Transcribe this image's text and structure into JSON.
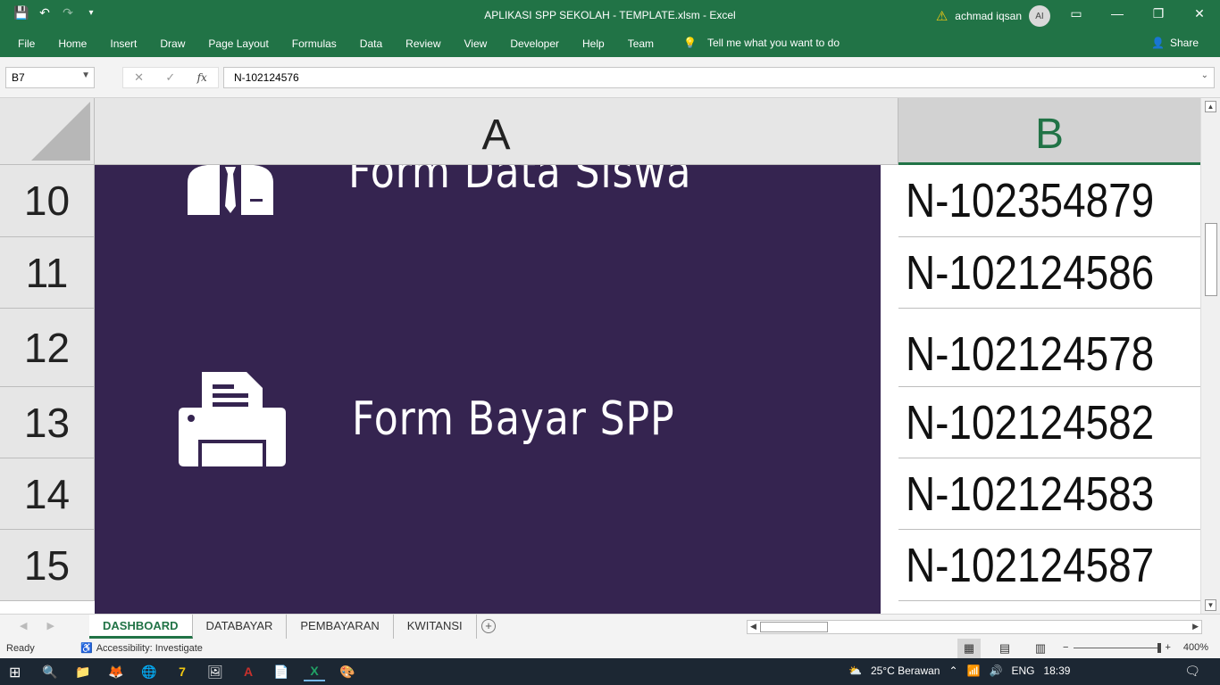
{
  "titlebar": {
    "title": "APLIKASI SPP SEKOLAH - TEMPLATE.xlsm  -  Excel",
    "user_name": "achmad iqsan",
    "avatar_initials": "AI"
  },
  "menu": [
    "File",
    "Home",
    "Insert",
    "Draw",
    "Page Layout",
    "Formulas",
    "Data",
    "Review",
    "View",
    "Developer",
    "Help",
    "Team"
  ],
  "tellme": "Tell me what you want to do",
  "share": "Share",
  "formula_bar": {
    "name_box": "B7",
    "fx": "fx",
    "value": "N-102124576"
  },
  "columns": {
    "a": "A",
    "b": "B"
  },
  "rows": [
    "10",
    "11",
    "12",
    "13",
    "14",
    "15"
  ],
  "panel": {
    "form_data_siswa": "Form Data Siswa",
    "form_bayar_spp": "Form Bayar SPP"
  },
  "column_b_values": [
    "N-102354879",
    "N-102124586",
    "N-102124578",
    "N-102124582",
    "N-102124583",
    "N-102124587"
  ],
  "sheets": [
    "DASHBOARD",
    "DATABAYAR",
    "PEMBAYARAN",
    "KWITANSI"
  ],
  "active_sheet": "DASHBOARD",
  "status": {
    "ready": "Ready",
    "accessibility": "Accessibility: Investigate",
    "zoom": "400%"
  },
  "taskbar": {
    "weather": "25°C  Berawan",
    "lang": "ENG",
    "time": "18:39"
  },
  "colors": {
    "excel_green": "#217346",
    "panel_purple": "#352450"
  }
}
